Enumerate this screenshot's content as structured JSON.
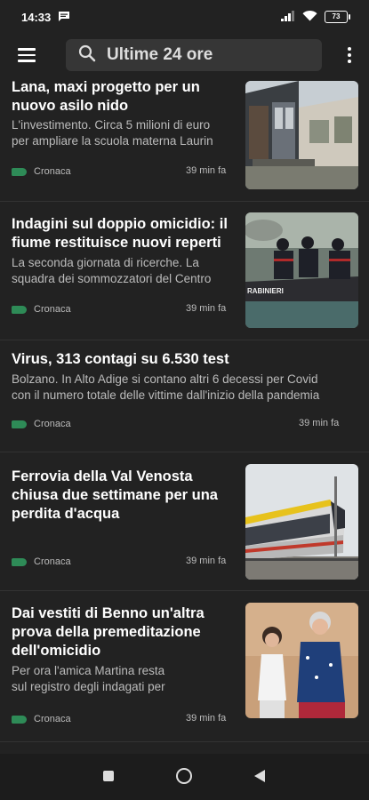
{
  "status_bar": {
    "time": "14:33",
    "battery": "73",
    "icons": [
      "message-icon",
      "signal-icon",
      "wifi-icon",
      "battery-icon"
    ]
  },
  "app_bar": {
    "search_text": "Ultime 24 ore",
    "icons": [
      "menu-icon",
      "search-icon",
      "more-vert-icon"
    ]
  },
  "articles": [
    {
      "title_lines": [
        "Lana, maxi progetto per un",
        "nuovo asilo nido"
      ],
      "snippet_lines": [
        "L'investimento. Circa 5 milioni di euro",
        "per ampliare la scuola materna Laurin"
      ],
      "category": "Cronaca",
      "time": "39 min fa",
      "image": "building-photo"
    },
    {
      "title_lines": [
        "Indagini sul doppio omicidio: il",
        "fiume restituisce nuovi reperti"
      ],
      "snippet_lines": [
        "La seconda giornata di ricerche. La",
        "squadra dei sommozzatori del Centro"
      ],
      "category": "Cronaca",
      "time": "39 min fa",
      "image": "carabinieri-boat-photo",
      "image_text": "RABINIERI"
    },
    {
      "title_lines": [
        "Virus, 313 contagi su 6.530 test"
      ],
      "snippet_lines": [
        "Bolzano. In Alto Adige si contano altri 6 decessi per Covid",
        "con il numero totale delle vittime dall'inizio della pandemia"
      ],
      "category": "Cronaca",
      "time": "39 min fa"
    },
    {
      "title_lines": [
        "Ferrovia della Val Venosta",
        "chiusa due settimane per una",
        "perdita d'acqua"
      ],
      "snippet_lines": [],
      "category": "Cronaca",
      "time": "39 min fa",
      "image": "train-photo"
    },
    {
      "title_lines": [
        "Dai vestiti di Benno un'altra",
        "prova della premeditazione",
        "dell'omicidio"
      ],
      "snippet_lines": [
        "Per ora l'amica Martina resta",
        "sul registro degli indagati per"
      ],
      "category": "Cronaca",
      "time": "39 min fa",
      "image": "two-people-photo"
    }
  ],
  "colors": {
    "background": "#222222",
    "tag": "#2e8b57",
    "search_bg": "#363636"
  }
}
